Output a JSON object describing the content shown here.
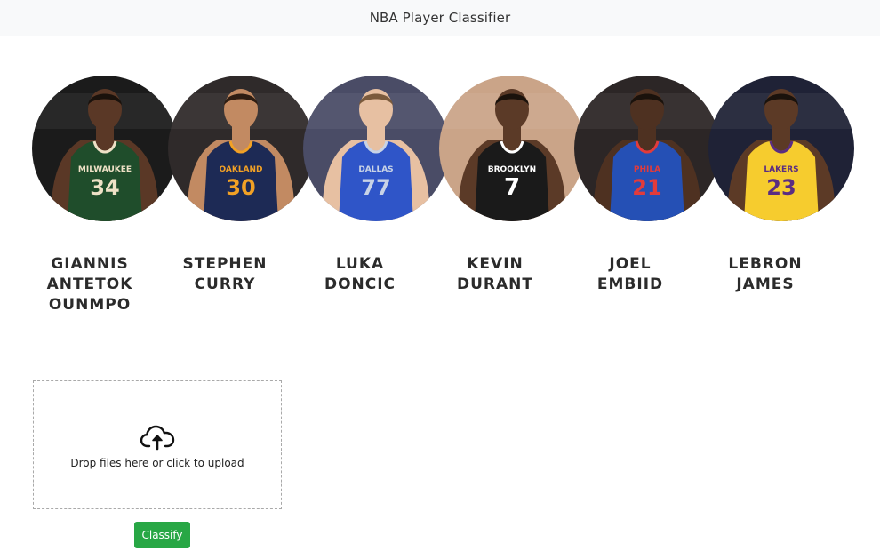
{
  "app": {
    "title": "NBA Player Classifier"
  },
  "players": [
    {
      "name_lines": [
        "GIANNIS",
        "ANTETOK",
        "OUNMPO"
      ],
      "jersey_text": "MILWAUKEE",
      "number": "34",
      "jersey_color": "#1f4d2b",
      "jersey_trim": "#eee1c6"
    },
    {
      "name_lines": [
        "STEPHEN",
        "CURRY"
      ],
      "jersey_text": "OAKLAND",
      "number": "30",
      "jersey_color": "#1d2a55",
      "jersey_trim": "#f2a125"
    },
    {
      "name_lines": [
        "LUKA",
        "DONCIC"
      ],
      "jersey_text": "DALLAS",
      "number": "77",
      "jersey_color": "#2f55c8",
      "jersey_trim": "#c8d3e6"
    },
    {
      "name_lines": [
        "KEVIN",
        "DURANT"
      ],
      "jersey_text": "BROOKLYN",
      "number": "7",
      "jersey_color": "#1a1a1a",
      "jersey_trim": "#ffffff"
    },
    {
      "name_lines": [
        "JOEL",
        "EMBIID"
      ],
      "jersey_text": "PHILA",
      "number": "21",
      "jersey_color": "#2550b5",
      "jersey_trim": "#e23b3b"
    },
    {
      "name_lines": [
        "LEBRON",
        "JAMES"
      ],
      "jersey_text": "LAKERS",
      "number": "23",
      "jersey_color": "#f6cc2e",
      "jersey_trim": "#5a2d82"
    }
  ],
  "upload": {
    "prompt": "Drop files here or click to upload",
    "icon": "cloud-upload-icon"
  },
  "actions": {
    "classify_label": "Classify",
    "classify_color": "#28a745"
  }
}
